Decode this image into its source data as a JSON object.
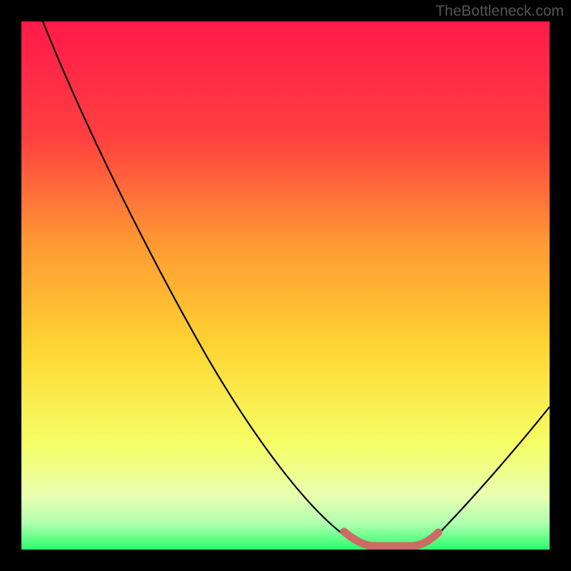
{
  "watermark": "TheBottleneck.com",
  "chart_data": {
    "type": "line",
    "title": "",
    "xlabel": "",
    "ylabel": "",
    "xlim": [
      0,
      100
    ],
    "ylim": [
      0,
      100
    ],
    "background_gradient": {
      "top": "#ff1a4a",
      "upper_mid": "#ff7a33",
      "mid": "#ffd633",
      "lower_mid": "#f5ff66",
      "bottom": "#2aff6a"
    },
    "curve": {
      "description": "V-shaped bottleneck curve",
      "points": [
        {
          "x": 4,
          "y": 100
        },
        {
          "x": 30,
          "y": 52
        },
        {
          "x": 55,
          "y": 12
        },
        {
          "x": 62,
          "y": 2
        },
        {
          "x": 65,
          "y": 0.5
        },
        {
          "x": 75,
          "y": 0.5
        },
        {
          "x": 78,
          "y": 2
        },
        {
          "x": 100,
          "y": 28
        }
      ]
    },
    "highlight_segment": {
      "color": "#cc6b66",
      "points": [
        {
          "x": 62,
          "y": 2.5
        },
        {
          "x": 64,
          "y": 1
        },
        {
          "x": 76,
          "y": 1
        },
        {
          "x": 78,
          "y": 2.5
        }
      ]
    }
  }
}
